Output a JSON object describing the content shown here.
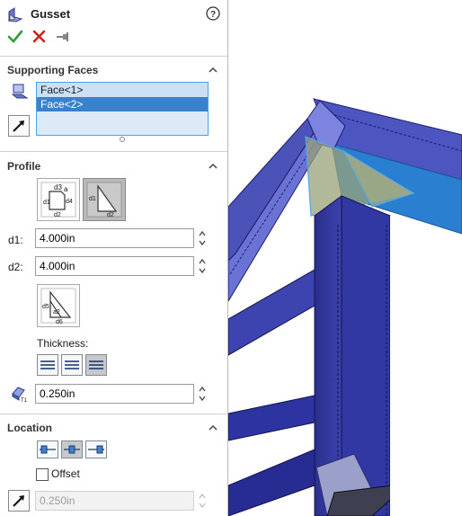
{
  "feature": {
    "title": "Gusset",
    "icon": "gusset-icon",
    "help_icon": "help-icon"
  },
  "actions": {
    "ok_icon": "checkmark-icon",
    "cancel_icon": "close-icon",
    "pin_icon": "pushpin-icon"
  },
  "supporting_faces": {
    "title": "Supporting Faces",
    "items": [
      {
        "label": "Face<1>",
        "state": "highlighted"
      },
      {
        "label": "Face<2>",
        "state": "selected"
      }
    ]
  },
  "profile": {
    "title": "Profile",
    "profile_type_1_labels": {
      "a": "d3",
      "b": "a",
      "c": "d1",
      "d": "d4",
      "e": "d2"
    },
    "profile_type_2_labels": {
      "a": "d1",
      "b": "d2"
    },
    "d1_label": "d1:",
    "d1_value": "4.000in",
    "d2_label": "d2:",
    "d2_value": "4.000in",
    "chamfer_labels": {
      "a": "d5",
      "b": "a2",
      "c": "d6"
    },
    "thickness_label": "Thickness:",
    "thickness_value": "0.250in"
  },
  "location": {
    "title": "Location",
    "offset_label": "Offset",
    "offset_value": "0.250in",
    "offset_checked": false
  },
  "colors": {
    "accent": "#3b82cc",
    "ok_green": "#2e9e3a",
    "cancel_red": "#d0201c",
    "frame": "#3a3aa8"
  }
}
